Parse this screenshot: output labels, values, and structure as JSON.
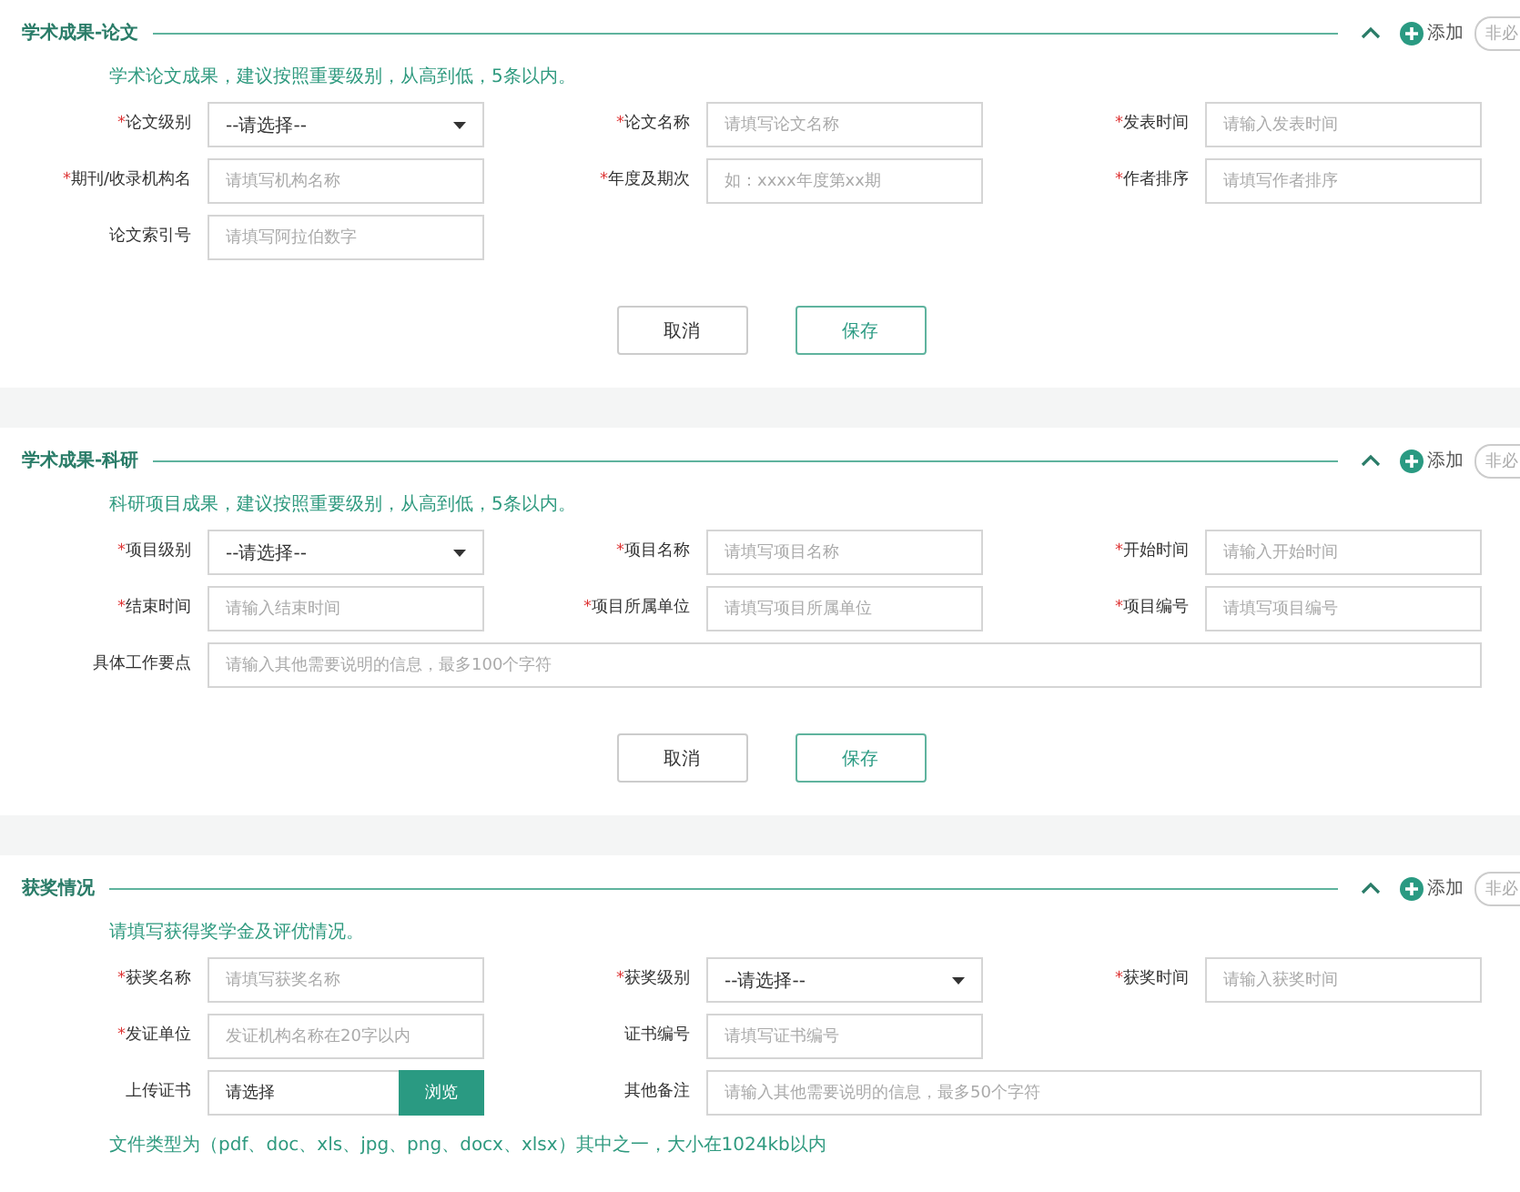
{
  "sections": [
    {
      "title": "学术成果-论文",
      "add_label": "添加",
      "optional_label": "非必",
      "hint": "学术论文成果，建议按照重要级别，从高到低，5条以内。",
      "rows": [
        [
          {
            "kind": "select",
            "required_mark": "*",
            "label": "论文级别",
            "value": "--请选择--"
          },
          {
            "kind": "input",
            "required_mark": "*",
            "label": "论文名称",
            "placeholder": "请填写论文名称"
          },
          {
            "kind": "input",
            "required_mark": "*",
            "label": "发表时间",
            "placeholder": "请输入发表时间"
          }
        ],
        [
          {
            "kind": "input",
            "required_mark": "*",
            "label": "期刊/收录机构名",
            "placeholder": "请填写机构名称"
          },
          {
            "kind": "input",
            "required_mark": "*",
            "label": "年度及期次",
            "placeholder": "如：xxxx年度第xx期"
          },
          {
            "kind": "input",
            "required_mark": "*",
            "label": "作者排序",
            "placeholder": "请填写作者排序"
          }
        ],
        [
          {
            "kind": "input",
            "label": "论文索引号",
            "placeholder": "请填写阿拉伯数字"
          }
        ]
      ],
      "buttons": [
        {
          "label": "取消",
          "kind": "cancel"
        },
        {
          "label": "保存",
          "kind": "save"
        }
      ]
    },
    {
      "title": "学术成果-科研",
      "add_label": "添加",
      "optional_label": "非必",
      "hint": "科研项目成果，建议按照重要级别，从高到低，5条以内。",
      "rows": [
        [
          {
            "kind": "select",
            "required_mark": "*",
            "label": "项目级别",
            "value": "--请选择--"
          },
          {
            "kind": "input",
            "required_mark": "*",
            "label": "项目名称",
            "placeholder": "请填写项目名称"
          },
          {
            "kind": "input",
            "required_mark": "*",
            "label": "开始时间",
            "placeholder": "请输入开始时间"
          }
        ],
        [
          {
            "kind": "input",
            "required_mark": "*",
            "label": "结束时间",
            "placeholder": "请输入结束时间"
          },
          {
            "kind": "input",
            "required_mark": "*",
            "label": "项目所属单位",
            "placeholder": "请填写项目所属单位"
          },
          {
            "kind": "input",
            "required_mark": "*",
            "label": "项目编号",
            "placeholder": "请填写项目编号"
          }
        ],
        [
          {
            "kind": "wide",
            "label": "具体工作要点",
            "placeholder": "请输入其他需要说明的信息，最多100个字符"
          }
        ]
      ],
      "buttons": [
        {
          "label": "取消",
          "kind": "cancel"
        },
        {
          "label": "保存",
          "kind": "save"
        }
      ]
    },
    {
      "title": "获奖情况",
      "add_label": "添加",
      "optional_label": "非必",
      "hint": "请填写获得奖学金及评优情况。",
      "rows": [
        [
          {
            "kind": "input",
            "required_mark": "*",
            "label": "获奖名称",
            "placeholder": "请填写获奖名称"
          },
          {
            "kind": "select",
            "required_mark": "*",
            "label": "获奖级别",
            "value": "--请选择--"
          },
          {
            "kind": "input",
            "required_mark": "*",
            "label": "获奖时间",
            "placeholder": "请输入获奖时间"
          }
        ],
        [
          {
            "kind": "input",
            "required_mark": "*",
            "label": "发证单位",
            "placeholder": "发证机构名称在20字以内"
          },
          {
            "kind": "input",
            "label": "证书编号",
            "placeholder": "请填写证书编号"
          }
        ],
        [
          {
            "kind": "file",
            "label": "上传证书",
            "value": "请选择",
            "button": "浏览"
          },
          {
            "kind": "wide",
            "label": "其他备注",
            "placeholder": "请输入其他需要说明的信息，最多50个字符"
          }
        ]
      ],
      "footnote": "文件类型为（pdf、doc、xls、jpg、png、docx、xlsx）其中之一，大小在1024kb以内"
    }
  ]
}
